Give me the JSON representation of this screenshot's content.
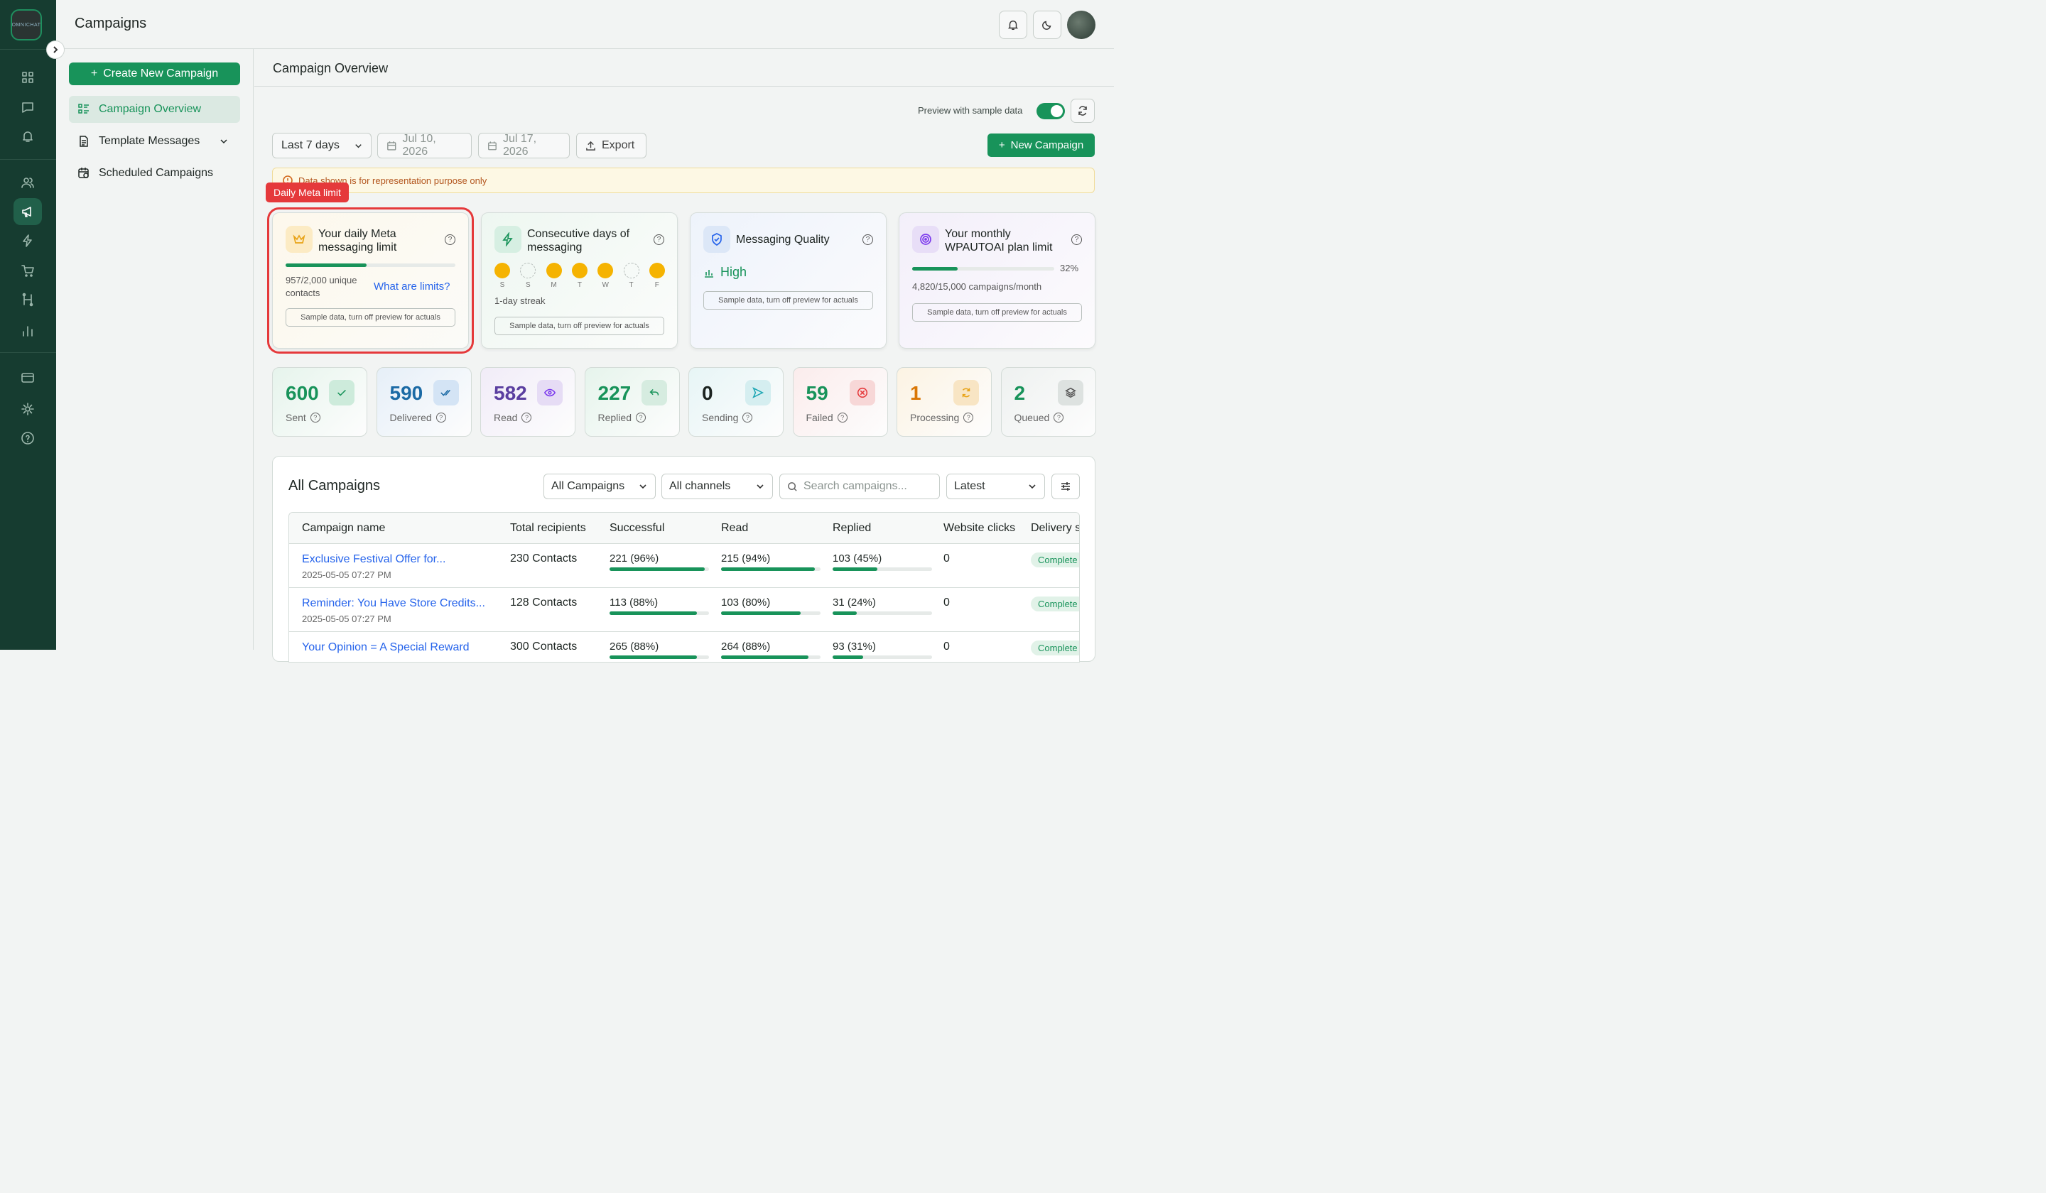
{
  "app": {
    "logo_text": "OMNICHAT",
    "page_title": "Campaigns"
  },
  "colors": {
    "primary": "#18935a",
    "rail": "#163c30",
    "danger": "#e5393b"
  },
  "rail_icons": [
    "dashboard-icon",
    "chat-icon",
    "bell-icon",
    "users-icon",
    "megaphone-icon",
    "lightning-icon",
    "cart-icon",
    "flow-icon",
    "bar-chart-icon",
    "card-icon",
    "gear-icon",
    "help-icon"
  ],
  "sidebar": {
    "create_label": "Create New Campaign",
    "items": [
      {
        "label": "Campaign Overview"
      },
      {
        "label": "Template Messages"
      },
      {
        "label": "Scheduled Campaigns"
      }
    ]
  },
  "main": {
    "title": "Campaign Overview",
    "preview_label": "Preview with sample data",
    "preview_on": true,
    "range_select": "Last 7 days",
    "date_from": "Jul 10, 2026",
    "date_to": "Jul 17, 2026",
    "export_label": "Export",
    "new_campaign_label": "New Campaign",
    "notice": "Data shown is for representation purpose only",
    "highlight_badge": "Daily Meta limit"
  },
  "cards": {
    "daily": {
      "title_1": "Your daily Meta",
      "title_2": "messaging limit",
      "usage": "957/2,000 unique",
      "usage_2": "contacts",
      "link": "What are limits?",
      "progress": 0.4785,
      "sample": "Sample data, turn off preview for actuals"
    },
    "streak": {
      "title_1": "Consecutive days of",
      "title_2": "messaging",
      "days": [
        "S",
        "S",
        "M",
        "T",
        "W",
        "T",
        "F"
      ],
      "active": [
        true,
        false,
        true,
        true,
        true,
        false,
        true
      ],
      "streak": "1-day streak",
      "sample": "Sample data, turn off preview for actuals"
    },
    "quality": {
      "title": "Messaging Quality",
      "value": "High",
      "sample": "Sample data, turn off preview for actuals"
    },
    "monthly": {
      "title_1": "Your monthly",
      "title_2": "WPAUTOAI plan limit",
      "percent": "32%",
      "progress": 0.32,
      "usage": "4,820/15,000 campaigns/month",
      "sample": "Sample data, turn off preview for actuals"
    }
  },
  "stats": [
    {
      "num": "600",
      "label": "Sent",
      "color": "#18935a",
      "icon": "check-icon"
    },
    {
      "num": "590",
      "label": "Delivered",
      "color": "#1b6aa5",
      "icon": "double-check-icon"
    },
    {
      "num": "582",
      "label": "Read",
      "color": "#5b3fa0",
      "icon": "eye-icon"
    },
    {
      "num": "227",
      "label": "Replied",
      "color": "#18935a",
      "icon": "reply-icon"
    },
    {
      "num": "0",
      "label": "Sending",
      "color": "#1c2320",
      "icon": "send-icon"
    },
    {
      "num": "59",
      "label": "Failed",
      "color": "#18935a",
      "icon": "x-circle-icon"
    },
    {
      "num": "1",
      "label": "Processing",
      "color": "#d97706",
      "icon": "refresh-icon"
    },
    {
      "num": "2",
      "label": "Queued",
      "color": "#18935a",
      "icon": "layers-icon"
    }
  ],
  "campaigns": {
    "title": "All Campaigns",
    "filter_type": "All Campaigns",
    "filter_channel": "All channels",
    "search_placeholder": "Search campaigns...",
    "sort": "Latest",
    "columns": [
      "Campaign name",
      "Total recipients",
      "Successful",
      "Read",
      "Replied",
      "Website clicks",
      "Delivery s"
    ],
    "rows": [
      {
        "name": "Exclusive Festival Offer for...",
        "date": "2025-05-05 07:27 PM",
        "total": "230 Contacts",
        "success": "221 (96%)",
        "success_p": 0.96,
        "read": "215 (94%)",
        "read_p": 0.94,
        "replied": "103 (45%)",
        "replied_p": 0.45,
        "clicks": "0",
        "status": "Complete"
      },
      {
        "name": "Reminder: You Have Store Credits...",
        "date": "2025-05-05 07:27 PM",
        "total": "128 Contacts",
        "success": "113 (88%)",
        "success_p": 0.88,
        "read": "103 (80%)",
        "read_p": 0.8,
        "replied": "31 (24%)",
        "replied_p": 0.24,
        "clicks": "0",
        "status": "Complete"
      },
      {
        "name": "Your Opinion = A Special Reward",
        "date": "",
        "total": "300 Contacts",
        "success": "265 (88%)",
        "success_p": 0.88,
        "read": "264 (88%)",
        "read_p": 0.88,
        "replied": "93 (31%)",
        "replied_p": 0.31,
        "clicks": "0",
        "status": "Complete"
      }
    ]
  }
}
